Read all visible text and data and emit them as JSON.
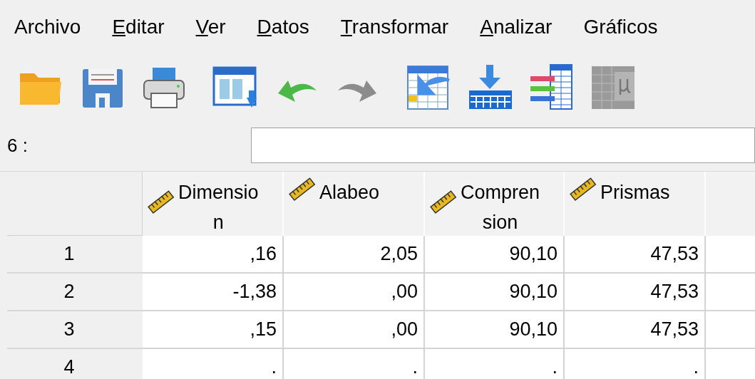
{
  "menu": [
    {
      "rest": "Archivo"
    },
    {
      "mnemonic": "E",
      "rest": "ditar"
    },
    {
      "mnemonic": "V",
      "rest": "er"
    },
    {
      "mnemonic": "D",
      "rest": "atos"
    },
    {
      "mnemonic": "T",
      "rest": "ransformar"
    },
    {
      "mnemonic": "A",
      "rest": "nalizar"
    },
    {
      "rest": "Gráficos"
    }
  ],
  "toolbar": [
    {
      "kind": "open"
    },
    {
      "kind": "save"
    },
    {
      "kind": "print"
    },
    {
      "kind": "dialog"
    },
    {
      "kind": "undo"
    },
    {
      "kind": "redo",
      "disabled": true
    },
    {
      "kind": "goto"
    },
    {
      "kind": "import"
    },
    {
      "kind": "variables"
    },
    {
      "kind": "stats",
      "disabled": true
    }
  ],
  "cell_ref": {
    "label": "6 :"
  },
  "table": {
    "columns": [
      {
        "lines": [
          "Dimensio",
          "n"
        ]
      },
      {
        "lines": [
          "Alabeo"
        ]
      },
      {
        "lines": [
          "Compren",
          "sion"
        ]
      },
      {
        "lines": [
          "Prismas"
        ]
      }
    ],
    "rows": [
      {
        "number": "1",
        "cells": [
          ",16",
          "2,05",
          "90,10",
          "47,53"
        ]
      },
      {
        "number": "2",
        "cells": [
          "-1,38",
          ",00",
          "90,10",
          "47,53"
        ]
      },
      {
        "number": "3",
        "cells": [
          ",15",
          ",00",
          "90,10",
          "47,53"
        ]
      },
      {
        "number": "4",
        "cells": [
          ".",
          ".",
          ".",
          "."
        ]
      }
    ]
  }
}
